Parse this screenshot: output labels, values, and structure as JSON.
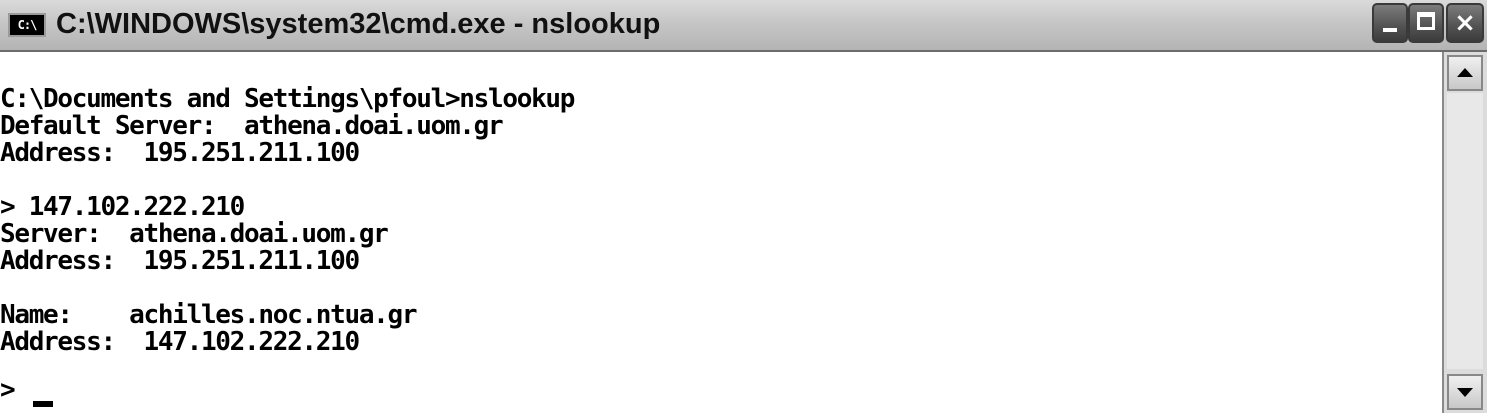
{
  "window": {
    "title": "C:\\WINDOWS\\system32\\cmd.exe - nslookup",
    "system_icon_text": "C:\\",
    "buttons": {
      "minimize": "minimize",
      "maximize": "maximize",
      "close": "×"
    }
  },
  "console": {
    "lines": [
      "C:\\Documents and Settings\\pfoul>nslookup",
      "Default Server:  athena.doai.uom.gr",
      "Address:  195.251.211.100",
      "",
      "> 147.102.222.210",
      "Server:  athena.doai.uom.gr",
      "Address:  195.251.211.100",
      "",
      "Name:    achilles.noc.ntua.gr",
      "Address:  147.102.222.210",
      "",
      ">"
    ]
  },
  "colors": {
    "console_background": "#ffffff",
    "console_text": "#000000",
    "titlebar": "#c6c6c6"
  }
}
